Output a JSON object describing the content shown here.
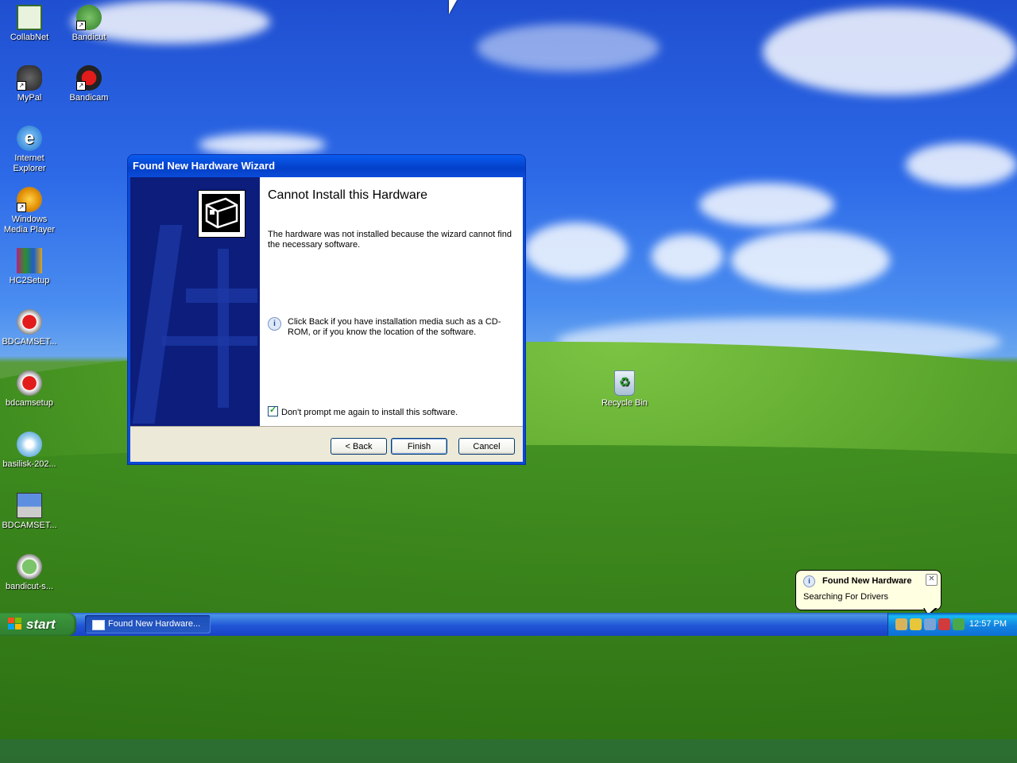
{
  "desktop": {
    "icons": [
      {
        "label": "CollabNet",
        "icon": "collabnet-icon"
      },
      {
        "label": "Bandicut",
        "icon": "bandicut-icon"
      },
      {
        "label": "MyPal",
        "icon": "mypal-icon"
      },
      {
        "label": "Bandicam",
        "icon": "bandicam-icon"
      },
      {
        "label": "Internet Explorer",
        "icon": "internet-explorer-icon"
      },
      {
        "label": "Windows Media Player",
        "icon": "media-player-icon"
      },
      {
        "label": "HC2Setup",
        "icon": "winrar-installer-icon"
      },
      {
        "label": "BDCAMSET...",
        "icon": "bandicam-setup-icon"
      },
      {
        "label": "bdcamsetup",
        "icon": "bandicam-setup-icon"
      },
      {
        "label": "basilisk-202...",
        "icon": "basilisk-installer-icon"
      },
      {
        "label": "BDCAMSET...",
        "icon": "setup-monitor-icon"
      },
      {
        "label": "bandicut-s...",
        "icon": "bandicut-setup-icon"
      },
      {
        "label": "Recycle Bin",
        "icon": "recycle-bin-icon"
      }
    ]
  },
  "wizard": {
    "title": "Found New Hardware Wizard",
    "heading": "Cannot Install this Hardware",
    "message": "The hardware was not installed because the wizard cannot find the necessary software.",
    "info_text": "Click Back if you have installation media such as a CD-ROM, or if you know the location of the software.",
    "checkbox_label": "Don't prompt me again to install this software.",
    "checkbox_checked": true,
    "buttons": {
      "back": "< Back",
      "finish": "Finish",
      "cancel": "Cancel"
    }
  },
  "taskbar": {
    "start_label": "start",
    "task_item_label": "Found New Hardware...",
    "clock": "12:57 PM"
  },
  "balloon": {
    "title": "Found New Hardware",
    "text": "Searching For Drivers"
  },
  "colors": {
    "title_bar": "#0a49d6",
    "start_green": "#388e38",
    "taskbar_blue": "#2157d7",
    "balloon_bg": "#ffffe1"
  }
}
